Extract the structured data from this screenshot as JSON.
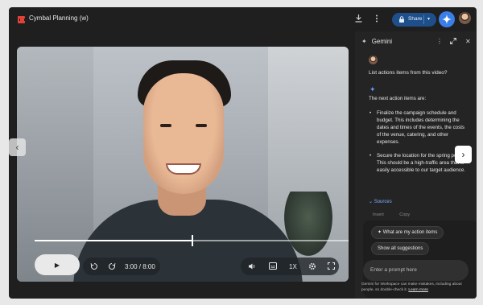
{
  "topbar": {
    "doc_title": "Cymbal Planning (w)",
    "download_icon": "download-icon",
    "more_icon": "more-vert-icon",
    "share_label": "Share",
    "share_icon": "lock-icon",
    "share_dropdown_icon": "chevron-down-icon",
    "gemini_icon": "gemini-sparkle-icon"
  },
  "video": {
    "time_display": "3:00 / 8:00",
    "progress": 0.5,
    "speed_label": "1X",
    "controls_icons": [
      "play-icon",
      "rewind-10-icon",
      "forward-10-icon",
      "volume-icon",
      "captions-icon",
      "settings-icon",
      "fullscreen-icon"
    ]
  },
  "nav": {
    "prev_icon": "chevron-left-icon",
    "next_icon": "chevron-right-icon"
  },
  "gemini_panel": {
    "title": "Gemini",
    "user_prompt": "List actions items from this video?",
    "answer_intro": "The next action items are:",
    "answer_items": [
      "Finalize the campaign schedule and budget. This includes determining the dates and times of the events, the costs of the venue, catering, and other expenses.",
      "Secure the location for the spring pop up. This should be a high-traffic area that is easily accessible to our target audience."
    ],
    "sources_label": "Sources",
    "faded_actions": [
      "Insert",
      "Copy"
    ],
    "suggestions": [
      "What are my action items",
      "Show all suggestions"
    ],
    "prompt_placeholder": "Enter a prompt here",
    "disclaimer_text": "Gemini for Workspace can make mistakes, including about people, so double-check it.",
    "learn_more": "Learn more"
  },
  "colors": {
    "accent_blue": "#3a7fe8",
    "share_bg": "#1e4f8a",
    "doc_icon": "#e2413a",
    "panel_bg": "#242424"
  }
}
